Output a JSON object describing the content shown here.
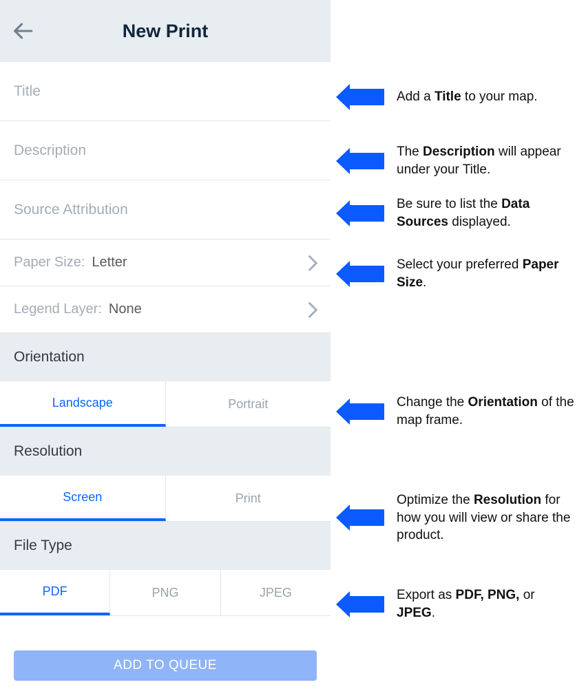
{
  "header": {
    "title": "New Print"
  },
  "fields": {
    "title_placeholder": "Title",
    "description_placeholder": "Description",
    "source_placeholder": "Source Attribution",
    "paper_size_label": "Paper Size:",
    "paper_size_value": "Letter",
    "legend_label": "Legend Layer:",
    "legend_value": "None"
  },
  "sections": {
    "orientation_label": "Orientation",
    "orientation_options": {
      "landscape": "Landscape",
      "portrait": "Portrait"
    },
    "resolution_label": "Resolution",
    "resolution_options": {
      "screen": "Screen",
      "print": "Print"
    },
    "filetype_label": "File Type",
    "filetype_options": {
      "pdf": "PDF",
      "png": "PNG",
      "jpeg": "JPEG"
    }
  },
  "queue_button": "ADD TO QUEUE",
  "callouts": {
    "title": {
      "pre": "Add a ",
      "bold": "Title",
      "post": " to your map."
    },
    "description": {
      "pre": "The ",
      "bold": "Description",
      "post": " will appear under your Title."
    },
    "source": {
      "pre": "Be sure to list the ",
      "bold": "Data Sources",
      "post": " displayed."
    },
    "paper": {
      "pre": "Select your preferred ",
      "bold": "Paper Size",
      "post": "."
    },
    "orientation": {
      "pre": "Change the ",
      "bold": "Orientation",
      "post": " of the map frame."
    },
    "resolution": {
      "pre": "Optimize the ",
      "bold": "Resolution",
      "post": " for how you will view or share the product."
    },
    "filetype": {
      "pre": "Export as ",
      "bold": "PDF, PNG,",
      "post_pre": " or ",
      "bold2": "JPEG",
      "post": "."
    }
  }
}
